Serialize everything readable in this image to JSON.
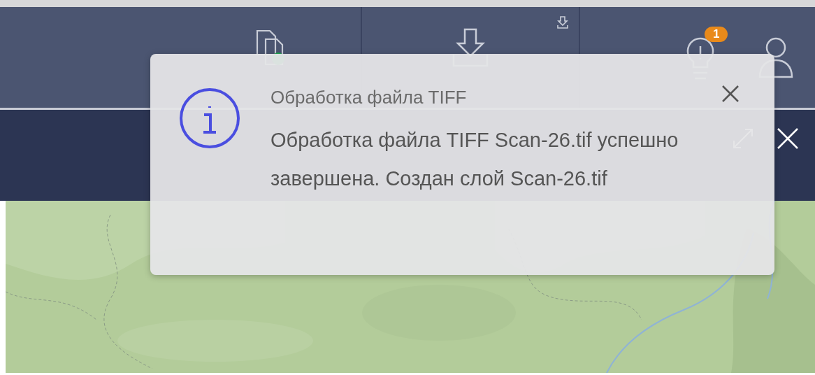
{
  "toolbar": {
    "items": [
      {
        "kind": "processes"
      },
      {
        "kind": "upload"
      }
    ],
    "notifications": {
      "badge": "1"
    }
  },
  "notification": {
    "title": "Обработка файла TIFF",
    "message": "Обработка файла TIFF Scan-26.tif успешно завершена. Создан слой Scan-26.tif"
  }
}
